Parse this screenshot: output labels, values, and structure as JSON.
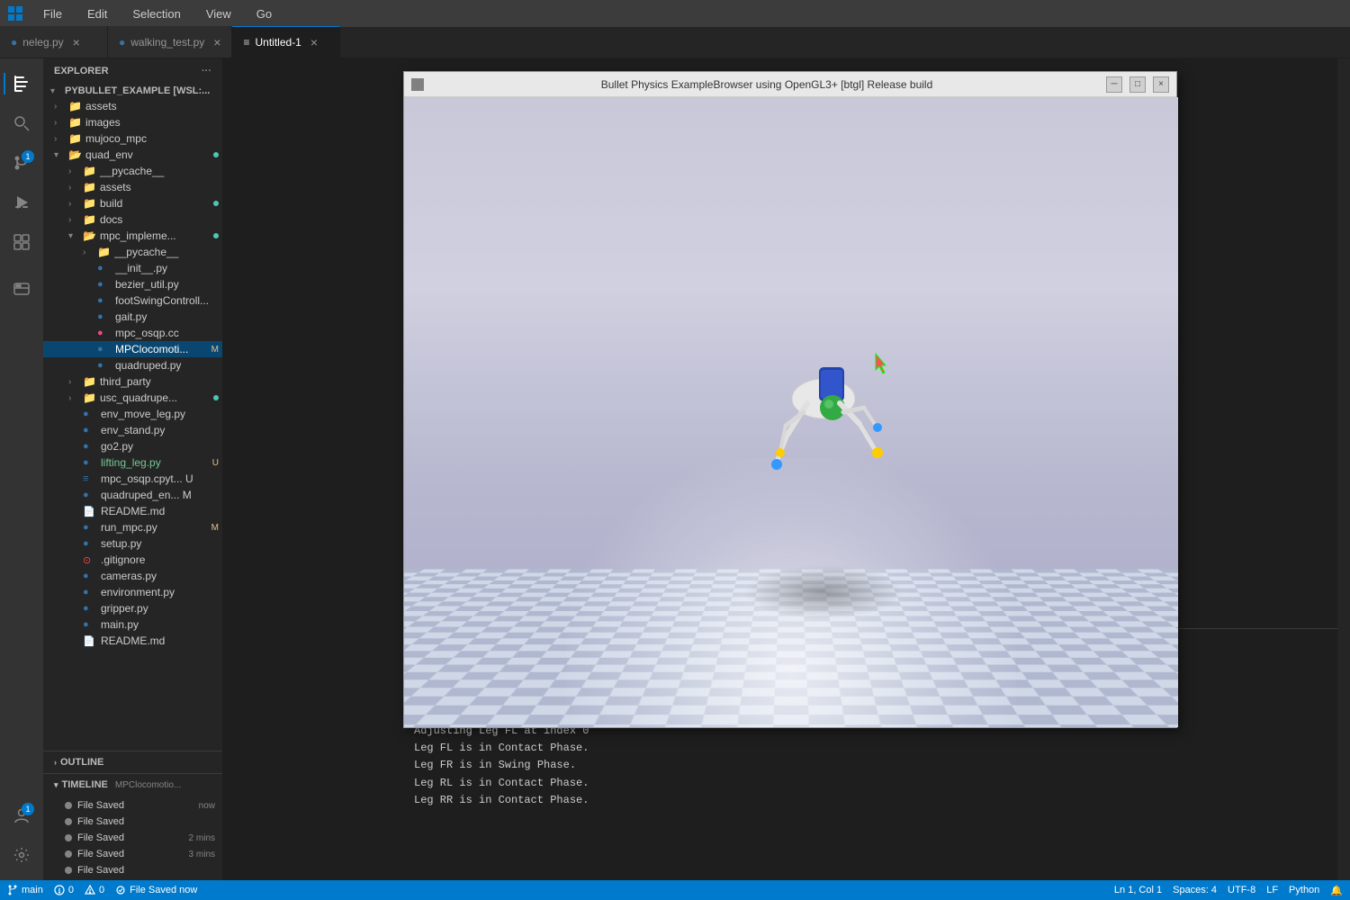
{
  "menu": {
    "items": [
      "File",
      "Edit",
      "Selection",
      "View",
      "Go"
    ]
  },
  "tabs": [
    {
      "id": "neleg",
      "label": "neleg.py",
      "active": false,
      "modified": false,
      "color": "#3572A5"
    },
    {
      "id": "walking_test",
      "label": "walking_test.py",
      "active": false,
      "modified": false,
      "color": "#3572A5"
    },
    {
      "id": "untitled",
      "label": "Untitled-1",
      "active": true,
      "modified": false,
      "color": "#cccccc"
    }
  ],
  "sidebar": {
    "header": "Explorer",
    "project": "PYBULLET_EXAMPLE [WSL:...",
    "items": [
      {
        "type": "folder",
        "label": "assets",
        "indent": 1,
        "expanded": false
      },
      {
        "type": "folder",
        "label": "images",
        "indent": 1,
        "expanded": false
      },
      {
        "type": "folder",
        "label": "mujoco_mpc",
        "indent": 1,
        "expanded": false
      },
      {
        "type": "folder",
        "label": "quad_env",
        "indent": 1,
        "expanded": true,
        "dot": true,
        "dotColor": "#4ec9b0"
      },
      {
        "type": "folder",
        "label": "__pycache__",
        "indent": 2,
        "expanded": false
      },
      {
        "type": "folder",
        "label": "assets",
        "indent": 2,
        "expanded": false
      },
      {
        "type": "folder",
        "label": "build",
        "indent": 2,
        "expanded": false,
        "dot": true,
        "dotColor": "#4ec9b0"
      },
      {
        "type": "folder",
        "label": "docs",
        "indent": 2,
        "expanded": false
      },
      {
        "type": "folder",
        "label": "mpc_impleme...",
        "indent": 2,
        "expanded": true,
        "dot": true,
        "dotColor": "#4ec9b0"
      },
      {
        "type": "folder",
        "label": "__pycache__",
        "indent": 3,
        "expanded": false
      },
      {
        "type": "file",
        "label": "__init__.py",
        "indent": 3,
        "ext": "py"
      },
      {
        "type": "file",
        "label": "bezier_util.py",
        "indent": 3,
        "ext": "py"
      },
      {
        "type": "file",
        "label": "footSwingControll...",
        "indent": 3,
        "ext": "py"
      },
      {
        "type": "file",
        "label": "gait.py",
        "indent": 3,
        "ext": "py"
      },
      {
        "type": "file",
        "label": "mpc_osqp.cc",
        "indent": 3,
        "ext": "cc"
      },
      {
        "type": "file",
        "label": "MPClocomotio... M",
        "indent": 3,
        "ext": "py",
        "active": true,
        "badge": "M"
      },
      {
        "type": "file",
        "label": "quadruped.py",
        "indent": 3,
        "ext": "py"
      },
      {
        "type": "folder",
        "label": "third_party",
        "indent": 2,
        "expanded": false
      },
      {
        "type": "folder",
        "label": "usc_quadrupe...",
        "indent": 2,
        "expanded": false,
        "dot": true,
        "dotColor": "#4ec9b0"
      },
      {
        "type": "file",
        "label": "env_move_leg.py",
        "indent": 2,
        "ext": "py"
      },
      {
        "type": "file",
        "label": "env_stand.py",
        "indent": 2,
        "ext": "py"
      },
      {
        "type": "file",
        "label": "go2.py",
        "indent": 2,
        "ext": "py"
      },
      {
        "type": "file",
        "label": "lifting_leg.py",
        "indent": 2,
        "ext": "py",
        "badge": "U"
      },
      {
        "type": "file",
        "label": "mpc_osqp.cpyt... U",
        "indent": 2,
        "ext": "py",
        "badge": "U"
      },
      {
        "type": "file",
        "label": "quadruped_en... M",
        "indent": 2,
        "ext": "py",
        "badge": "M"
      },
      {
        "type": "file",
        "label": "README.md",
        "indent": 2,
        "ext": "md"
      },
      {
        "type": "file",
        "label": "run_mpc.py",
        "indent": 2,
        "ext": "py",
        "badge": "M"
      },
      {
        "type": "file",
        "label": "setup.py",
        "indent": 2,
        "ext": "py"
      },
      {
        "type": "file",
        "label": ".gitignore",
        "indent": 2,
        "ext": "git"
      },
      {
        "type": "file",
        "label": "cameras.py",
        "indent": 2,
        "ext": "py"
      },
      {
        "type": "file",
        "label": "environment.py",
        "indent": 2,
        "ext": "py"
      },
      {
        "type": "file",
        "label": "gripper.py",
        "indent": 2,
        "ext": "py"
      },
      {
        "type": "file",
        "label": "main.py",
        "indent": 2,
        "ext": "py"
      },
      {
        "type": "file",
        "label": "README.md",
        "indent": 2,
        "ext": "md"
      }
    ]
  },
  "outline": {
    "title": "OUTLINE"
  },
  "timeline": {
    "title": "TIMELINE",
    "file": "MPClocomotio...",
    "items": [
      {
        "label": "File Saved",
        "time": "now"
      },
      {
        "label": "File Saved",
        "time": ""
      },
      {
        "label": "File Saved",
        "time": "2 mins"
      },
      {
        "label": "File Saved",
        "time": "3 mins"
      },
      {
        "label": "File Saved",
        "time": ""
      }
    ]
  },
  "physics_window": {
    "title": "Bullet Physics ExampleBrowser using OpenGL3+ [btgl] Release build"
  },
  "terminal": {
    "lines": [
      "Adjusting Leg FL at index 0",
      "Leg FL is in Contact Phase.",
      "Leg FR is in Swing Phase.",
      "Leg RL is in Contact Phase.",
      "Leg RR is in Contact Phase.",
      "Adjusting Leg FL at index 0",
      "Leg FL is in Contact Phase.",
      "Leg FR is in Swing Phase.",
      "Leg RL is in Contact Phase.",
      "Leg RR is in Contact Phase."
    ]
  },
  "status_bar": {
    "git_branch": "main",
    "errors": "0",
    "warnings": "0",
    "file_saved": "File Saved  now",
    "line_col": "Ln 1, Col 1",
    "spaces": "Spaces: 4",
    "encoding": "UTF-8",
    "line_ending": "LF",
    "language": "Python"
  },
  "activity_icons": [
    {
      "name": "explorer",
      "icon": "📄",
      "active": true
    },
    {
      "name": "search",
      "icon": "🔍",
      "active": false
    },
    {
      "name": "source-control",
      "icon": "⎇",
      "active": false,
      "badge": "1"
    },
    {
      "name": "run-debug",
      "icon": "▶",
      "active": false
    },
    {
      "name": "extensions",
      "icon": "⊞",
      "active": false
    },
    {
      "name": "remote-explorer",
      "icon": "🖥",
      "active": false
    }
  ]
}
